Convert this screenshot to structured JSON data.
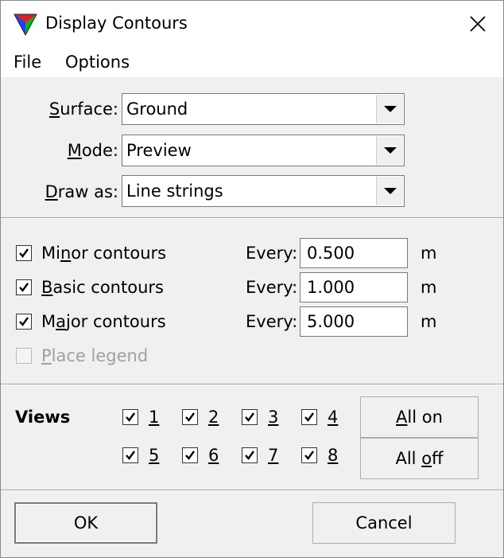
{
  "window": {
    "title": "Display Contours",
    "icon": "tri-color-app-icon",
    "close": "close-icon"
  },
  "menu": {
    "items": [
      "File",
      "Options"
    ]
  },
  "form": {
    "surface": {
      "label_ul": "S",
      "label_rest": "urface:",
      "value": "Ground"
    },
    "mode": {
      "label_ul": "M",
      "label_rest": "ode:",
      "value": "Preview"
    },
    "draw_as": {
      "label_ul": "D",
      "label_rest": "raw as:",
      "value": "Line strings"
    }
  },
  "contours": {
    "minor": {
      "label_pre": "Mi",
      "label_ul": "n",
      "label_post": "or contours",
      "checked": true,
      "every_label": "Every:",
      "value": "0.500",
      "unit": "m"
    },
    "basic": {
      "label_pre": "",
      "label_ul": "B",
      "label_post": "asic contours",
      "checked": true,
      "every_label": "Every:",
      "value": "1.000",
      "unit": "m"
    },
    "major": {
      "label_pre": "M",
      "label_ul": "a",
      "label_post": "jor contours",
      "checked": true,
      "every_label": "Every:",
      "value": "5.000",
      "unit": "m"
    },
    "legend": {
      "label_pre": "",
      "label_ul": "P",
      "label_post": "lace legend",
      "checked": false,
      "disabled": true
    }
  },
  "views": {
    "title": "Views",
    "items": [
      {
        "label": "1",
        "checked": true
      },
      {
        "label": "2",
        "checked": true
      },
      {
        "label": "3",
        "checked": true
      },
      {
        "label": "4",
        "checked": true
      },
      {
        "label": "5",
        "checked": true
      },
      {
        "label": "6",
        "checked": true
      },
      {
        "label": "7",
        "checked": true
      },
      {
        "label": "8",
        "checked": true
      }
    ],
    "all_on": {
      "pre": "",
      "ul": "A",
      "post": "ll on"
    },
    "all_off": {
      "pre": "All ",
      "ul": "o",
      "post": "ff"
    }
  },
  "buttons": {
    "ok": "OK",
    "cancel": "Cancel"
  },
  "colors": {
    "dialog_bg": "#f0f0f0",
    "title_bg": "#ffffff",
    "border": "#7a7a7a",
    "disabled_text": "#a0a0a0"
  }
}
